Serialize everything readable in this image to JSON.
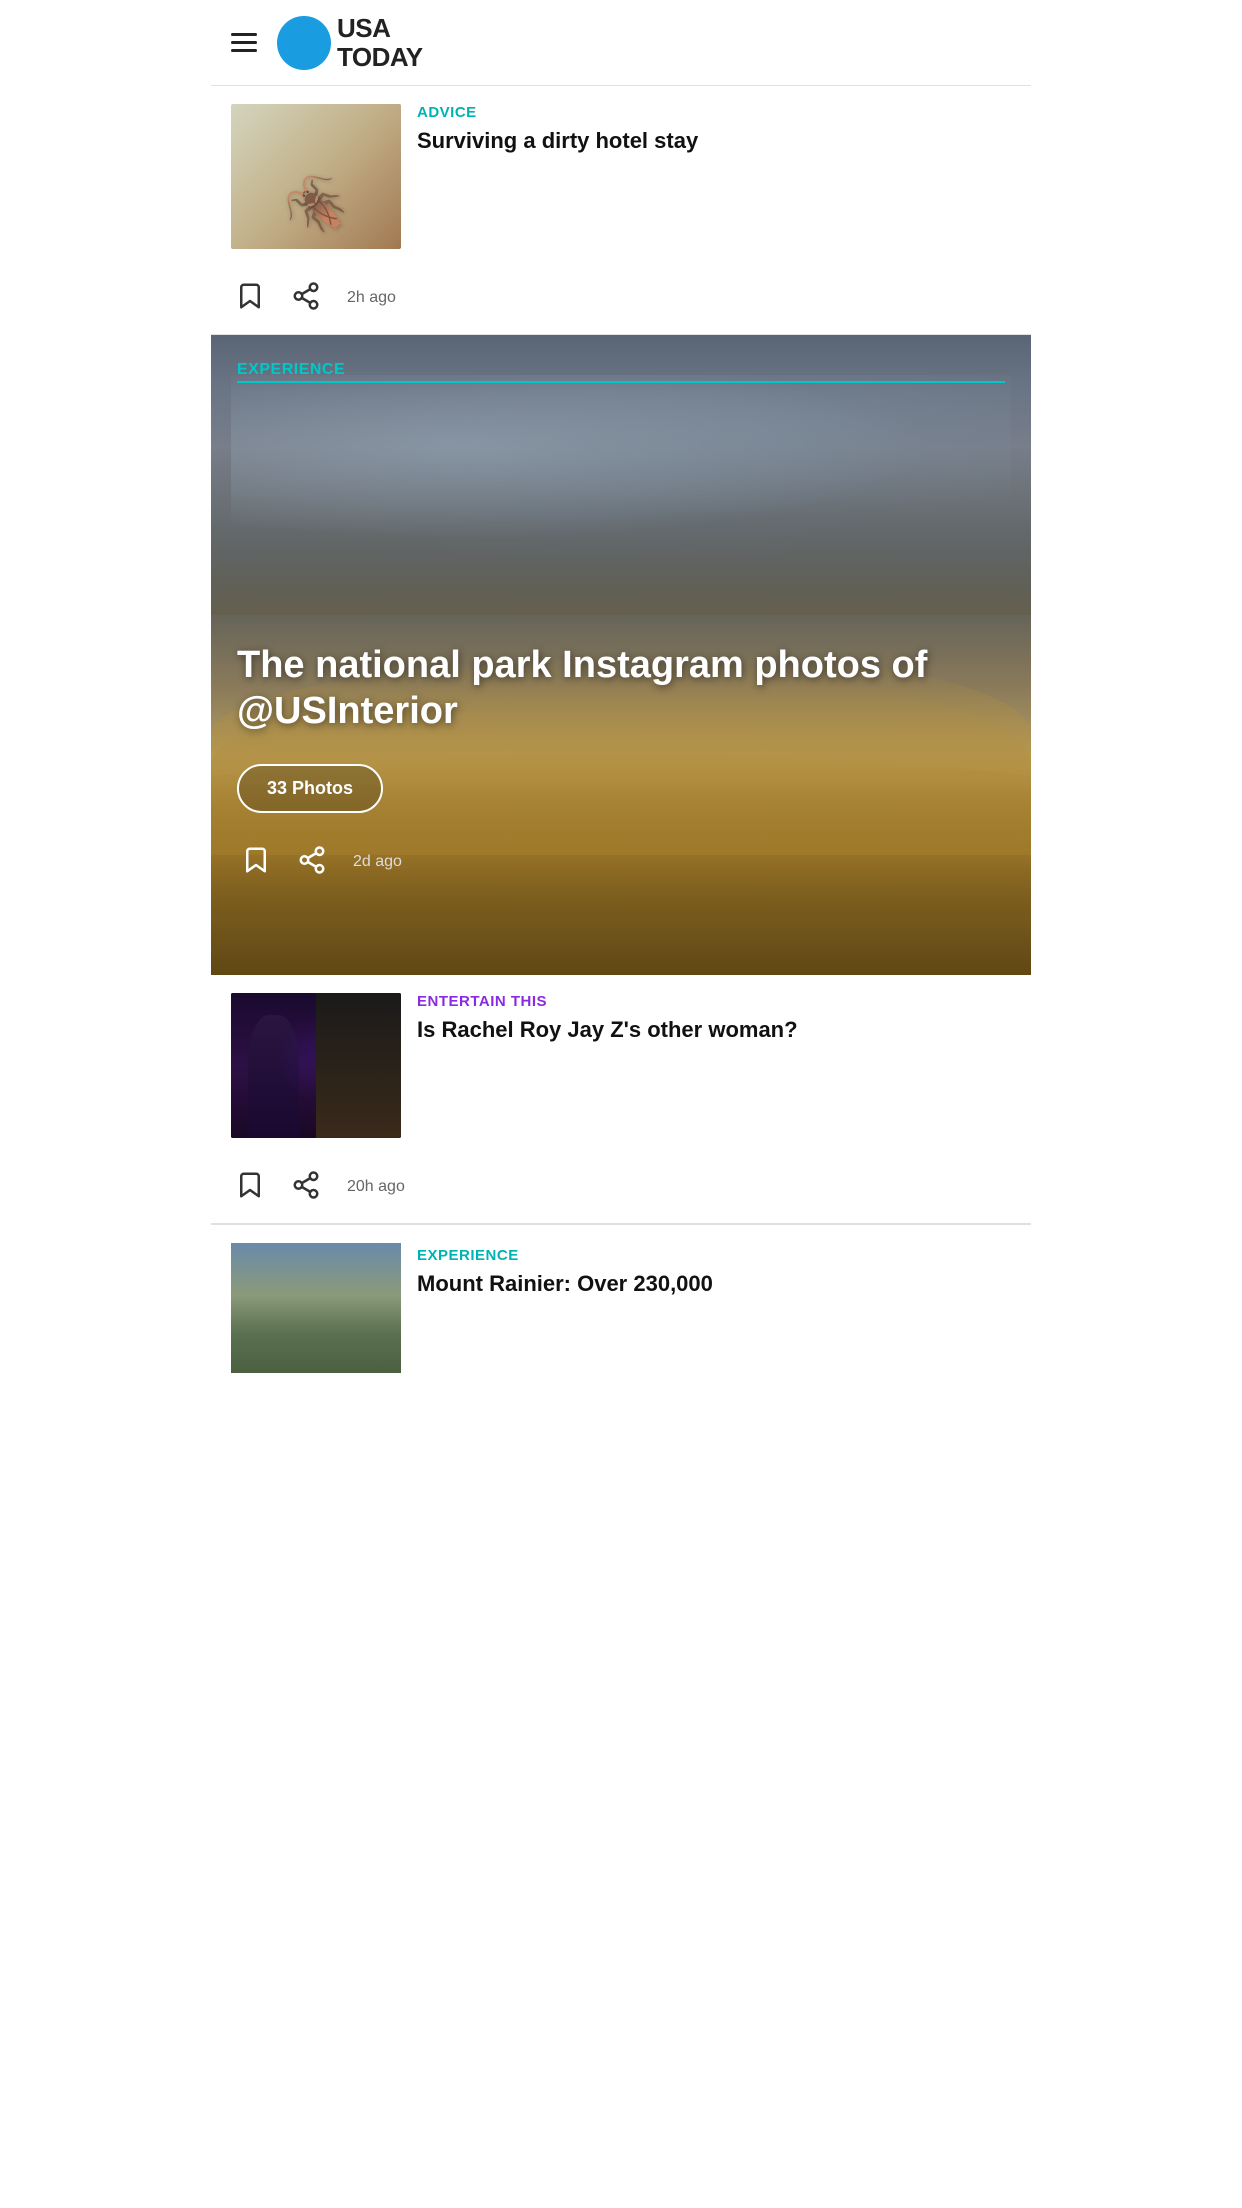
{
  "header": {
    "menu_label": "Menu",
    "logo_text_line1": "USA",
    "logo_text_line2": "TODAY"
  },
  "articles": [
    {
      "id": "advice-hotel",
      "category": "ADVICE",
      "category_type": "advice",
      "title": "Surviving a dirty hotel stay",
      "timestamp": "2h ago",
      "image_type": "cockroach"
    },
    {
      "id": "experience-national-park",
      "category": "EXPERIENCE",
      "category_type": "experience",
      "title": "The national park Instagram photos of @USInterior",
      "photos_label": "33 Photos",
      "timestamp": "2d ago",
      "image_type": "featured",
      "is_featured": true
    },
    {
      "id": "entertain-rachel-roy",
      "category": "ENTERTAIN THIS",
      "category_type": "entertain",
      "title": "Is Rachel Roy Jay Z's other woman?",
      "timestamp": "20h ago",
      "image_type": "couple"
    },
    {
      "id": "experience-mount-rainier",
      "category": "EXPERIENCE",
      "category_type": "experience",
      "title": "Mount Rainier: Over 230,000",
      "timestamp": "",
      "image_type": "mountain",
      "is_partial": true
    }
  ],
  "icons": {
    "bookmark": "bookmark",
    "share": "share"
  }
}
